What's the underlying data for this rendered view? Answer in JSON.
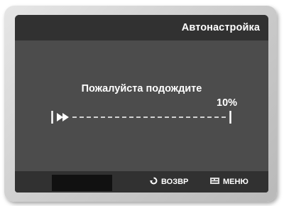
{
  "screen": {
    "title": "Автонастройка",
    "message": "Пожалуйста подождите",
    "progress": {
      "percent_text": "10%",
      "value": 0.1
    }
  },
  "footer": {
    "back_label": "ВОЗВР",
    "back_icon": "return-icon",
    "menu_label": "МЕНЮ",
    "menu_icon": "menu-icon"
  }
}
